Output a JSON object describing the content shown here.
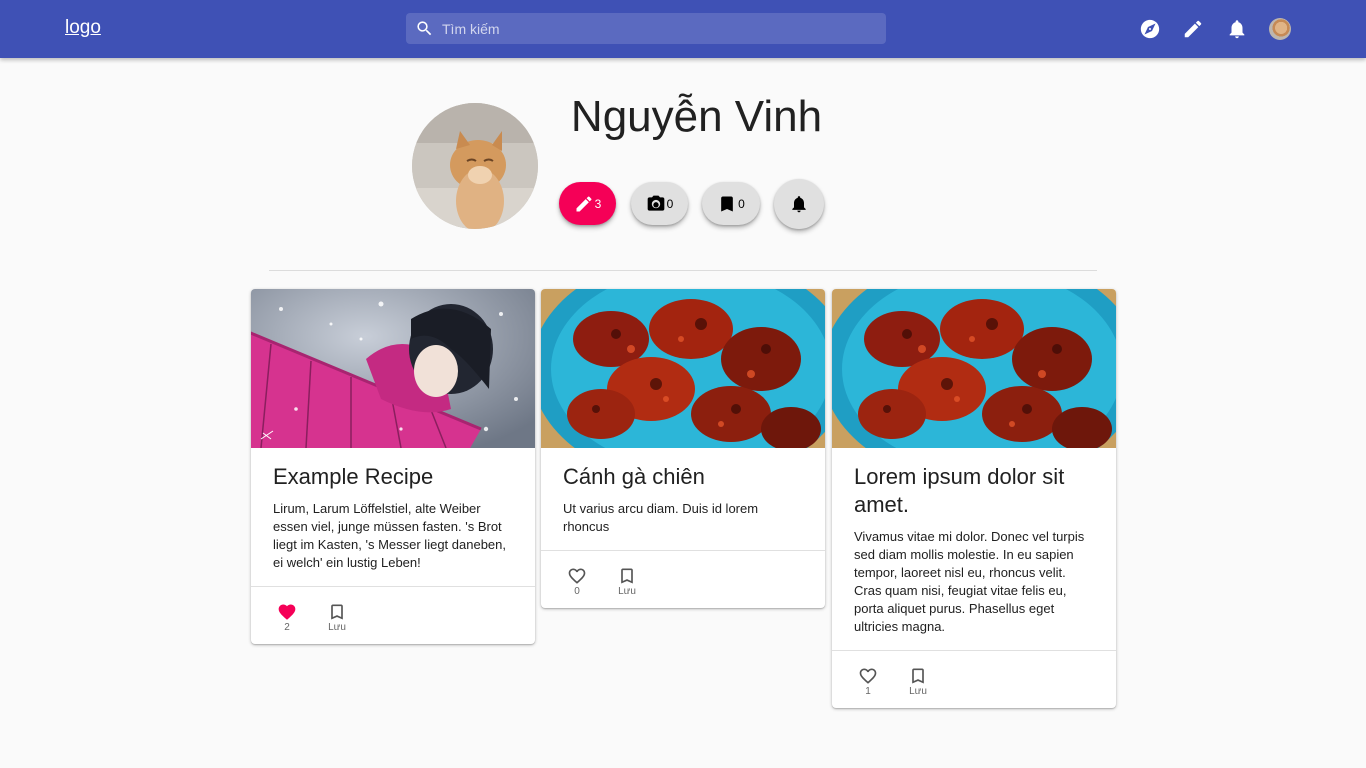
{
  "header": {
    "logo": "logo",
    "search_placeholder": "Tìm kiếm",
    "icons": [
      "compass-icon",
      "pencil-icon",
      "bell-icon",
      "avatar"
    ]
  },
  "profile": {
    "name": "Nguyễn Vinh",
    "posts_count": "3",
    "photos_count": "0",
    "saved_count": "0"
  },
  "colors": {
    "appbar": "#3f51b5",
    "accent": "#f50057",
    "background": "#fafafa"
  },
  "cards": [
    {
      "title": "Example Recipe",
      "description": "Lirum, Larum Löffelstiel, alte Weiber essen viel, junge müssen fasten. 's Brot liegt im Kasten, 's Messer liegt daneben, ei welch' ein lustig Leben!",
      "likes": "2",
      "liked": true,
      "save_label": "Lưu"
    },
    {
      "title": "Cánh gà chiên",
      "description": "Ut varius arcu diam. Duis id lorem rhoncus",
      "likes": "0",
      "liked": false,
      "save_label": "Lưu"
    },
    {
      "title": "Lorem ipsum dolor sit amet.",
      "description": "Vivamus vitae mi dolor. Donec vel turpis sed diam mollis molestie. In eu sapien tempor, laoreet nisl eu, rhoncus velit. Cras quam nisi, feugiat vitae felis eu, porta aliquet purus. Phasellus eget ultricies magna.",
      "likes": "1",
      "liked": false,
      "save_label": "Lưu"
    }
  ]
}
